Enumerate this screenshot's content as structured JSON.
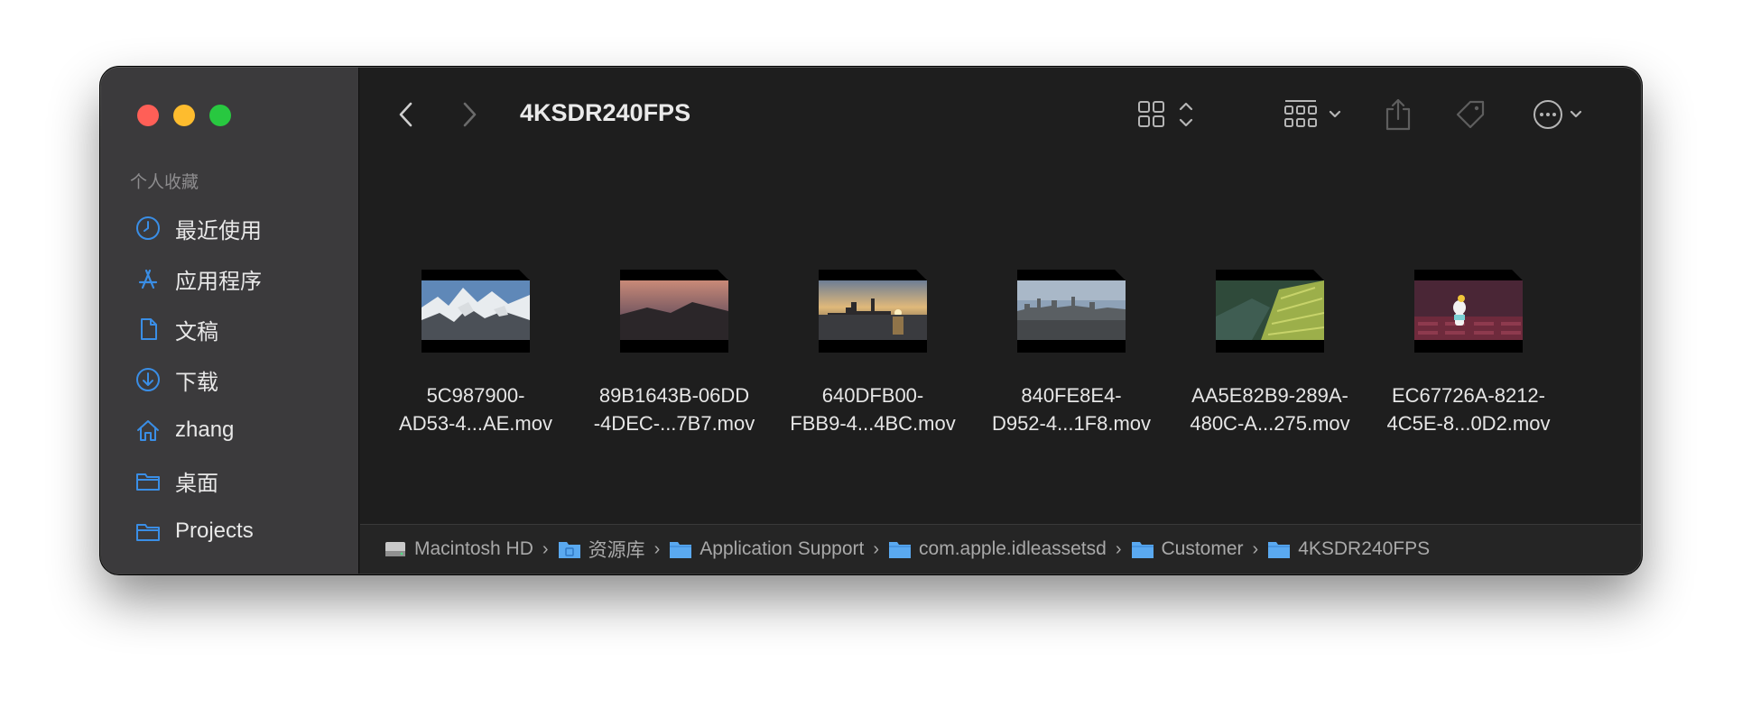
{
  "window": {
    "title": "4KSDR240FPS"
  },
  "sidebar": {
    "heading": "个人收藏",
    "items": [
      {
        "label": "最近使用",
        "icon": "clock-icon"
      },
      {
        "label": "应用程序",
        "icon": "applications-icon"
      },
      {
        "label": "文稿",
        "icon": "document-icon"
      },
      {
        "label": "下载",
        "icon": "download-icon"
      },
      {
        "label": "zhang",
        "icon": "home-icon"
      },
      {
        "label": "桌面",
        "icon": "folder-icon"
      },
      {
        "label": "Projects",
        "icon": "folder-icon"
      }
    ]
  },
  "files": [
    {
      "line1": "5C987900-",
      "line2": "AD53-4...AE.mov",
      "thumb": "snowy-mountains"
    },
    {
      "line1": "89B1643B-06DD",
      "line2": "-4DEC-...7B7.mov",
      "thumb": "sunset-ridge"
    },
    {
      "line1": "640DFB00-",
      "line2": "FBB9-4...4BC.mov",
      "thumb": "city-sunrise"
    },
    {
      "line1": "840FE8E4-",
      "line2": "D952-4...1F8.mov",
      "thumb": "aerial-city"
    },
    {
      "line1": "AA5E82B9-289A-",
      "line2": "480C-A...275.mov",
      "thumb": "green-forest"
    },
    {
      "line1": "EC67726A-8212-",
      "line2": "4C5E-8...0D2.mov",
      "thumb": "snoopy-theater"
    }
  ],
  "pathbar": [
    {
      "label": "Macintosh HD",
      "icon": "hard-drive-icon"
    },
    {
      "label": "资源库",
      "icon": "library-folder-icon"
    },
    {
      "label": "Application Support",
      "icon": "folder-icon"
    },
    {
      "label": "com.apple.idleassetsd",
      "icon": "folder-icon"
    },
    {
      "label": "Customer",
      "icon": "folder-icon"
    },
    {
      "label": "4KSDR240FPS",
      "icon": "folder-icon"
    }
  ],
  "colors": {
    "accent": "#3a8ee6",
    "folder": "#5aa9f0"
  }
}
